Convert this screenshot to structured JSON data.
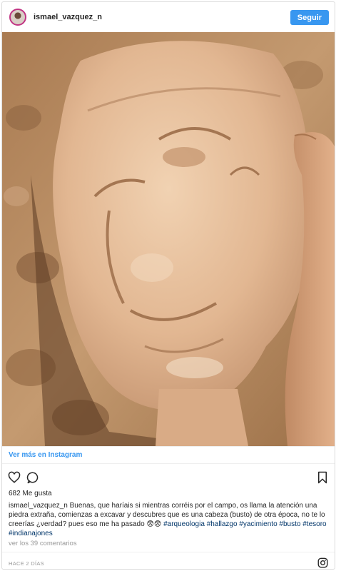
{
  "header": {
    "username": "ismael_vazquez_n",
    "follow_label": "Seguir"
  },
  "photo": {
    "subject": "stone-head-sculpture"
  },
  "view_more_label": "Ver más en Instagram",
  "actions": {
    "like_icon": "heart-icon",
    "comment_icon": "comment-icon",
    "save_icon": "bookmark-icon"
  },
  "likes_text": "682 Me gusta",
  "caption": {
    "user": "ismael_vazquez_n",
    "text": " Buenas, que haríais si mientras corréis por el campo, os llama la atención una piedra extraña, comienzas a excavar y descubres que es una cabeza (busto) de otra época, no te lo creerías ¿verdad? pues eso me ha pasado 😨😨 ",
    "tags": [
      "#arqueologia",
      "#hallazgo",
      "#yacimiento",
      "#busto",
      "#tesoro",
      "#indianajones"
    ]
  },
  "comments_text": "ver los 39 comentarios",
  "time_text": "HACE 2 DÍAS",
  "colors": {
    "accent": "#3897f0",
    "hashtag": "#003569",
    "border": "#dbdbdb"
  }
}
